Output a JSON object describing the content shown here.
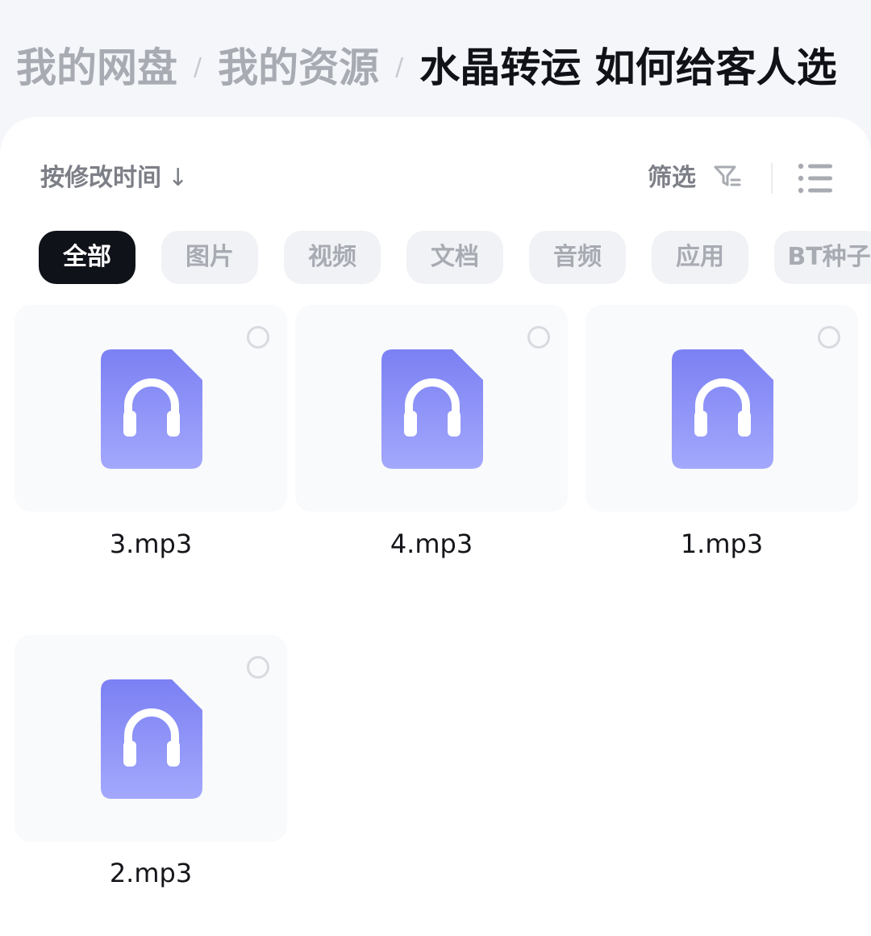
{
  "breadcrumb": {
    "items": [
      "我的网盘",
      "我的资源",
      "水晶转运 如何给客人选"
    ],
    "separator": "/"
  },
  "toolbar": {
    "sort_label": "按修改时间",
    "sort_arrow": "↓",
    "filter_label": "筛选",
    "view_icon": "list-view-icon"
  },
  "tabs": [
    {
      "label": "全部",
      "active": true
    },
    {
      "label": "图片",
      "active": false
    },
    {
      "label": "视频",
      "active": false
    },
    {
      "label": "文档",
      "active": false
    },
    {
      "label": "音频",
      "active": false
    },
    {
      "label": "应用",
      "active": false
    },
    {
      "label": "BT种子",
      "active": false
    }
  ],
  "files": [
    {
      "name": "3.mp3",
      "icon": "audio-file-icon",
      "selected": false
    },
    {
      "name": "4.mp3",
      "icon": "audio-file-icon",
      "selected": false
    },
    {
      "name": "1.mp3",
      "icon": "audio-file-icon",
      "selected": false
    },
    {
      "name": "2.mp3",
      "icon": "audio-file-icon",
      "selected": false
    }
  ],
  "colors": {
    "accent_icon_top": "#7b80f3",
    "accent_icon_bottom": "#a3a8fc",
    "active_tab_bg": "#0f1218"
  }
}
